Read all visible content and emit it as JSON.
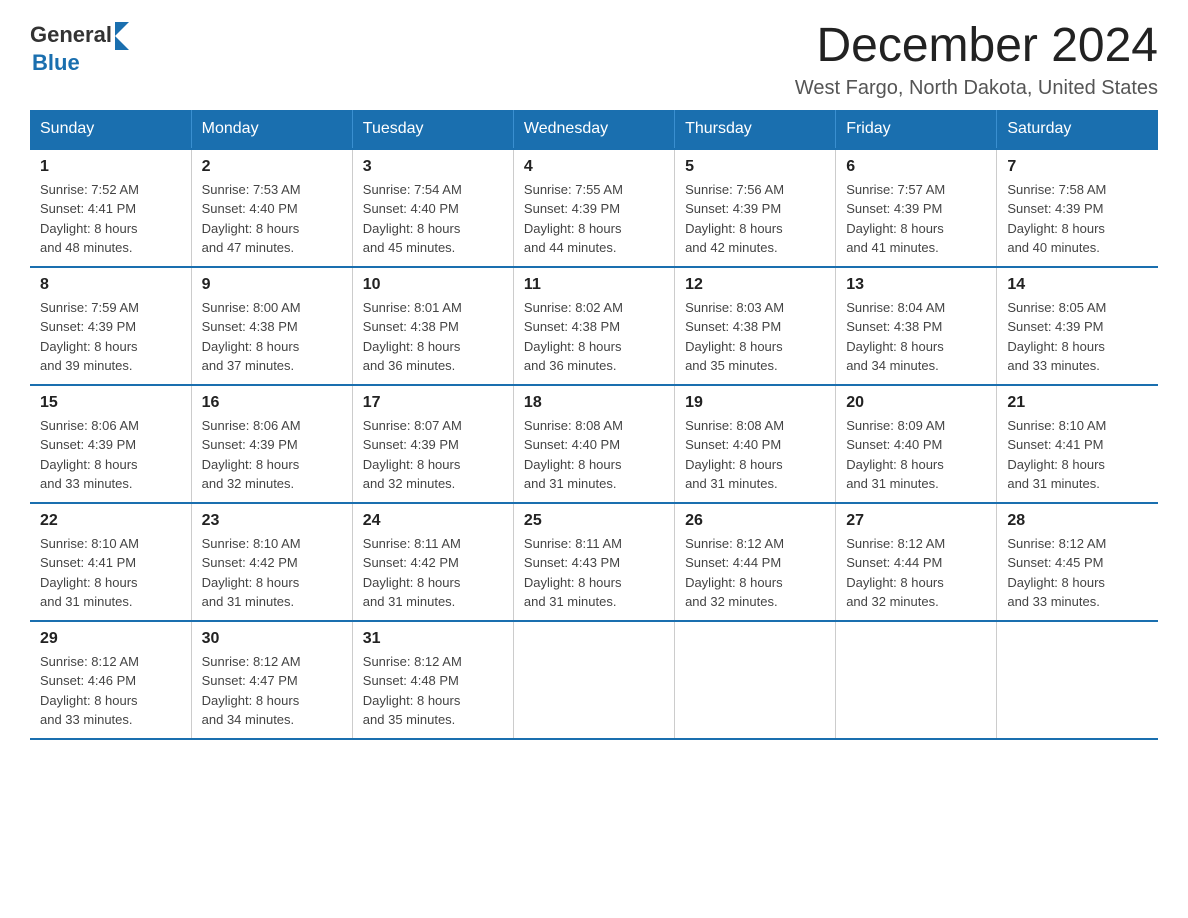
{
  "logo": {
    "text_general": "General",
    "text_blue": "Blue"
  },
  "title": "December 2024",
  "subtitle": "West Fargo, North Dakota, United States",
  "days_of_week": [
    "Sunday",
    "Monday",
    "Tuesday",
    "Wednesday",
    "Thursday",
    "Friday",
    "Saturday"
  ],
  "weeks": [
    [
      {
        "day": "1",
        "sunrise": "7:52 AM",
        "sunset": "4:41 PM",
        "daylight": "8 hours and 48 minutes."
      },
      {
        "day": "2",
        "sunrise": "7:53 AM",
        "sunset": "4:40 PM",
        "daylight": "8 hours and 47 minutes."
      },
      {
        "day": "3",
        "sunrise": "7:54 AM",
        "sunset": "4:40 PM",
        "daylight": "8 hours and 45 minutes."
      },
      {
        "day": "4",
        "sunrise": "7:55 AM",
        "sunset": "4:39 PM",
        "daylight": "8 hours and 44 minutes."
      },
      {
        "day": "5",
        "sunrise": "7:56 AM",
        "sunset": "4:39 PM",
        "daylight": "8 hours and 42 minutes."
      },
      {
        "day": "6",
        "sunrise": "7:57 AM",
        "sunset": "4:39 PM",
        "daylight": "8 hours and 41 minutes."
      },
      {
        "day": "7",
        "sunrise": "7:58 AM",
        "sunset": "4:39 PM",
        "daylight": "8 hours and 40 minutes."
      }
    ],
    [
      {
        "day": "8",
        "sunrise": "7:59 AM",
        "sunset": "4:39 PM",
        "daylight": "8 hours and 39 minutes."
      },
      {
        "day": "9",
        "sunrise": "8:00 AM",
        "sunset": "4:38 PM",
        "daylight": "8 hours and 37 minutes."
      },
      {
        "day": "10",
        "sunrise": "8:01 AM",
        "sunset": "4:38 PM",
        "daylight": "8 hours and 36 minutes."
      },
      {
        "day": "11",
        "sunrise": "8:02 AM",
        "sunset": "4:38 PM",
        "daylight": "8 hours and 36 minutes."
      },
      {
        "day": "12",
        "sunrise": "8:03 AM",
        "sunset": "4:38 PM",
        "daylight": "8 hours and 35 minutes."
      },
      {
        "day": "13",
        "sunrise": "8:04 AM",
        "sunset": "4:38 PM",
        "daylight": "8 hours and 34 minutes."
      },
      {
        "day": "14",
        "sunrise": "8:05 AM",
        "sunset": "4:39 PM",
        "daylight": "8 hours and 33 minutes."
      }
    ],
    [
      {
        "day": "15",
        "sunrise": "8:06 AM",
        "sunset": "4:39 PM",
        "daylight": "8 hours and 33 minutes."
      },
      {
        "day": "16",
        "sunrise": "8:06 AM",
        "sunset": "4:39 PM",
        "daylight": "8 hours and 32 minutes."
      },
      {
        "day": "17",
        "sunrise": "8:07 AM",
        "sunset": "4:39 PM",
        "daylight": "8 hours and 32 minutes."
      },
      {
        "day": "18",
        "sunrise": "8:08 AM",
        "sunset": "4:40 PM",
        "daylight": "8 hours and 31 minutes."
      },
      {
        "day": "19",
        "sunrise": "8:08 AM",
        "sunset": "4:40 PM",
        "daylight": "8 hours and 31 minutes."
      },
      {
        "day": "20",
        "sunrise": "8:09 AM",
        "sunset": "4:40 PM",
        "daylight": "8 hours and 31 minutes."
      },
      {
        "day": "21",
        "sunrise": "8:10 AM",
        "sunset": "4:41 PM",
        "daylight": "8 hours and 31 minutes."
      }
    ],
    [
      {
        "day": "22",
        "sunrise": "8:10 AM",
        "sunset": "4:41 PM",
        "daylight": "8 hours and 31 minutes."
      },
      {
        "day": "23",
        "sunrise": "8:10 AM",
        "sunset": "4:42 PM",
        "daylight": "8 hours and 31 minutes."
      },
      {
        "day": "24",
        "sunrise": "8:11 AM",
        "sunset": "4:42 PM",
        "daylight": "8 hours and 31 minutes."
      },
      {
        "day": "25",
        "sunrise": "8:11 AM",
        "sunset": "4:43 PM",
        "daylight": "8 hours and 31 minutes."
      },
      {
        "day": "26",
        "sunrise": "8:12 AM",
        "sunset": "4:44 PM",
        "daylight": "8 hours and 32 minutes."
      },
      {
        "day": "27",
        "sunrise": "8:12 AM",
        "sunset": "4:44 PM",
        "daylight": "8 hours and 32 minutes."
      },
      {
        "day": "28",
        "sunrise": "8:12 AM",
        "sunset": "4:45 PM",
        "daylight": "8 hours and 33 minutes."
      }
    ],
    [
      {
        "day": "29",
        "sunrise": "8:12 AM",
        "sunset": "4:46 PM",
        "daylight": "8 hours and 33 minutes."
      },
      {
        "day": "30",
        "sunrise": "8:12 AM",
        "sunset": "4:47 PM",
        "daylight": "8 hours and 34 minutes."
      },
      {
        "day": "31",
        "sunrise": "8:12 AM",
        "sunset": "4:48 PM",
        "daylight": "8 hours and 35 minutes."
      },
      null,
      null,
      null,
      null
    ]
  ],
  "labels": {
    "sunrise": "Sunrise:",
    "sunset": "Sunset:",
    "daylight": "Daylight:"
  }
}
